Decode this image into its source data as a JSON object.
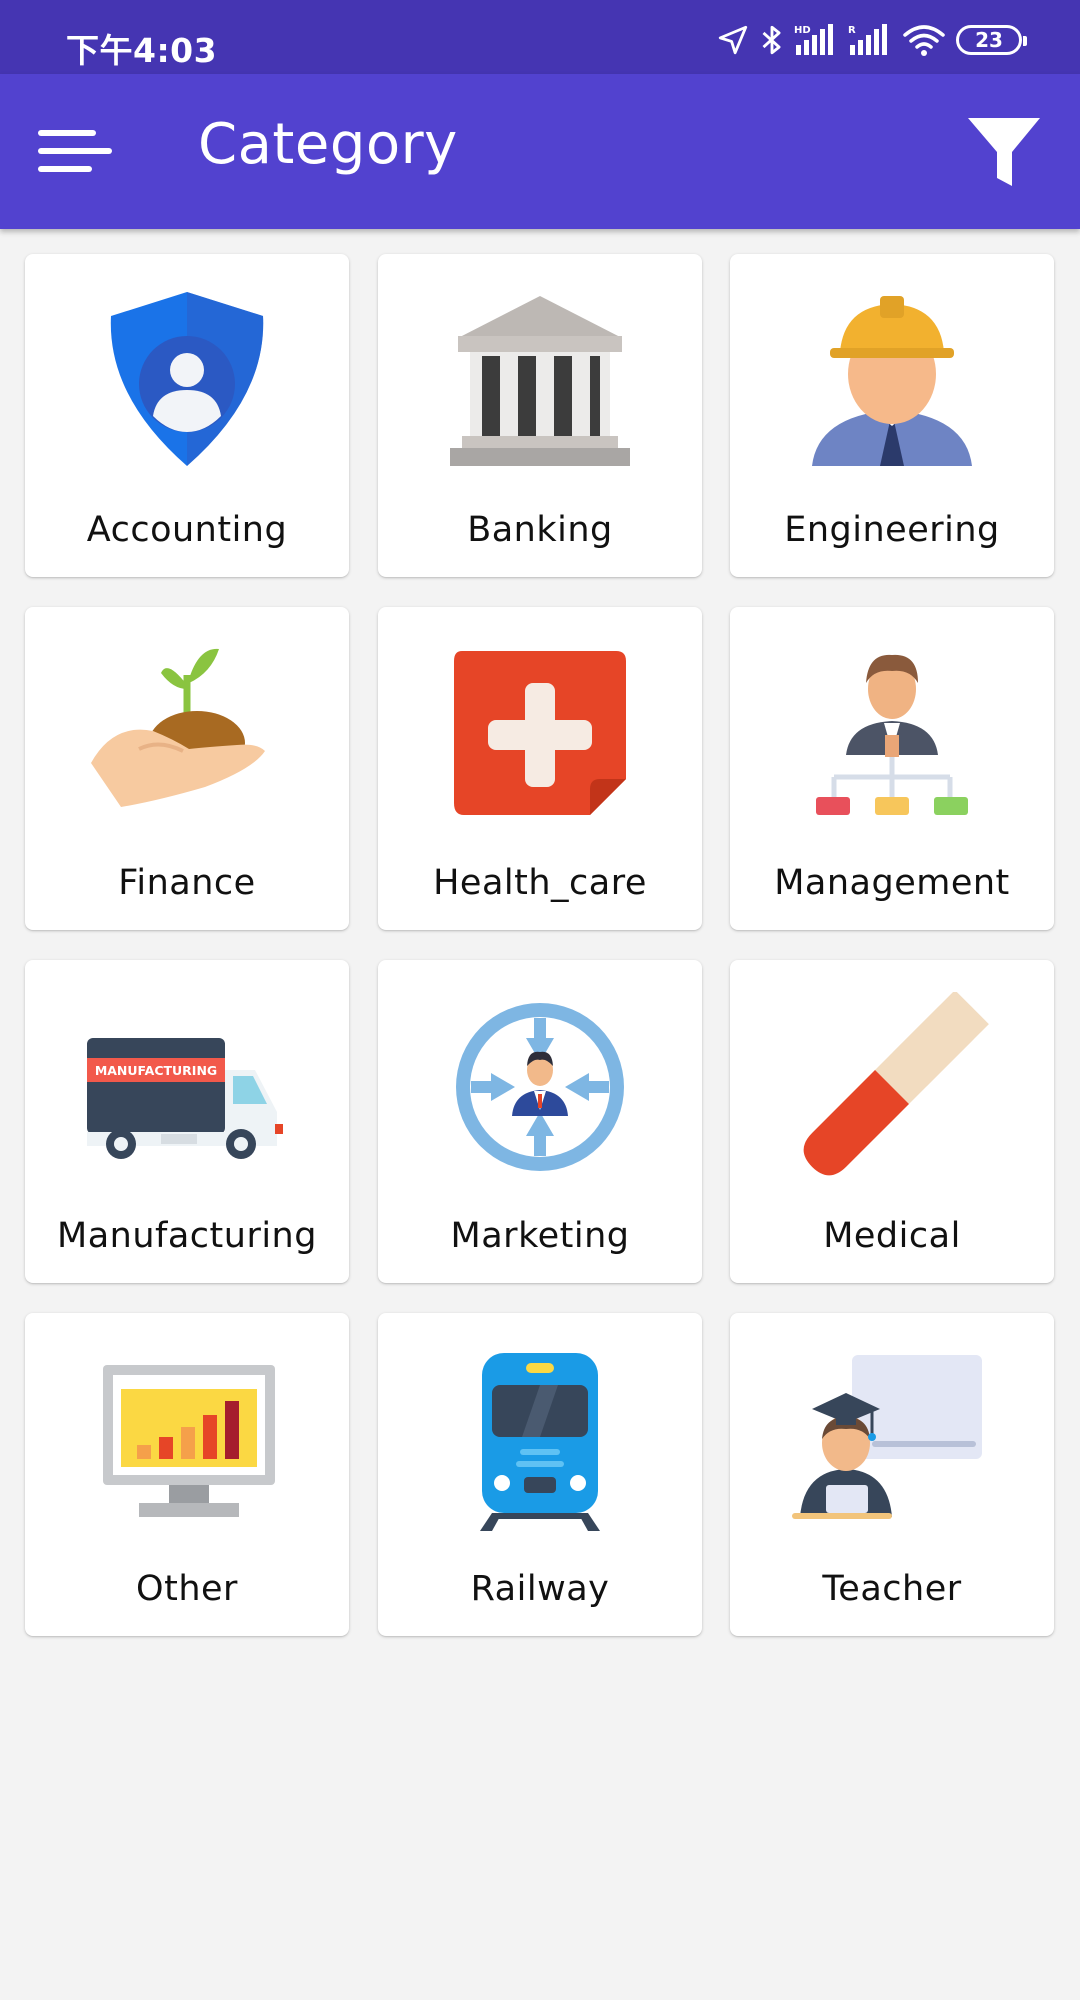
{
  "status_bar": {
    "time": "下午4:03",
    "battery": "23",
    "icons": [
      "location-icon",
      "bluetooth-icon",
      "hd-signal-icon",
      "r-signal-icon",
      "wifi-icon",
      "battery-icon"
    ]
  },
  "app_bar": {
    "title": "Category",
    "menu_icon": "hamburger-menu-icon",
    "filter_icon": "filter-icon",
    "color": "#5242cf"
  },
  "categories": [
    {
      "label": "Accounting",
      "icon": "shield-user-icon"
    },
    {
      "label": "Banking",
      "icon": "bank-building-icon"
    },
    {
      "label": "Engineering",
      "icon": "engineer-hardhat-icon"
    },
    {
      "label": "Finance",
      "icon": "hand-plant-icon"
    },
    {
      "label": "Health_care",
      "icon": "medical-cross-icon"
    },
    {
      "label": "Management",
      "icon": "manager-hierarchy-icon"
    },
    {
      "label": "Manufacturing",
      "icon": "manufacturing-truck-icon",
      "truck_text": "MANUFACTURING"
    },
    {
      "label": "Marketing",
      "icon": "marketing-target-icon"
    },
    {
      "label": "Medical",
      "icon": "pill-capsule-icon"
    },
    {
      "label": "Other",
      "icon": "monitor-chart-icon"
    },
    {
      "label": "Railway",
      "icon": "train-icon"
    },
    {
      "label": "Teacher",
      "icon": "teacher-board-icon"
    }
  ]
}
